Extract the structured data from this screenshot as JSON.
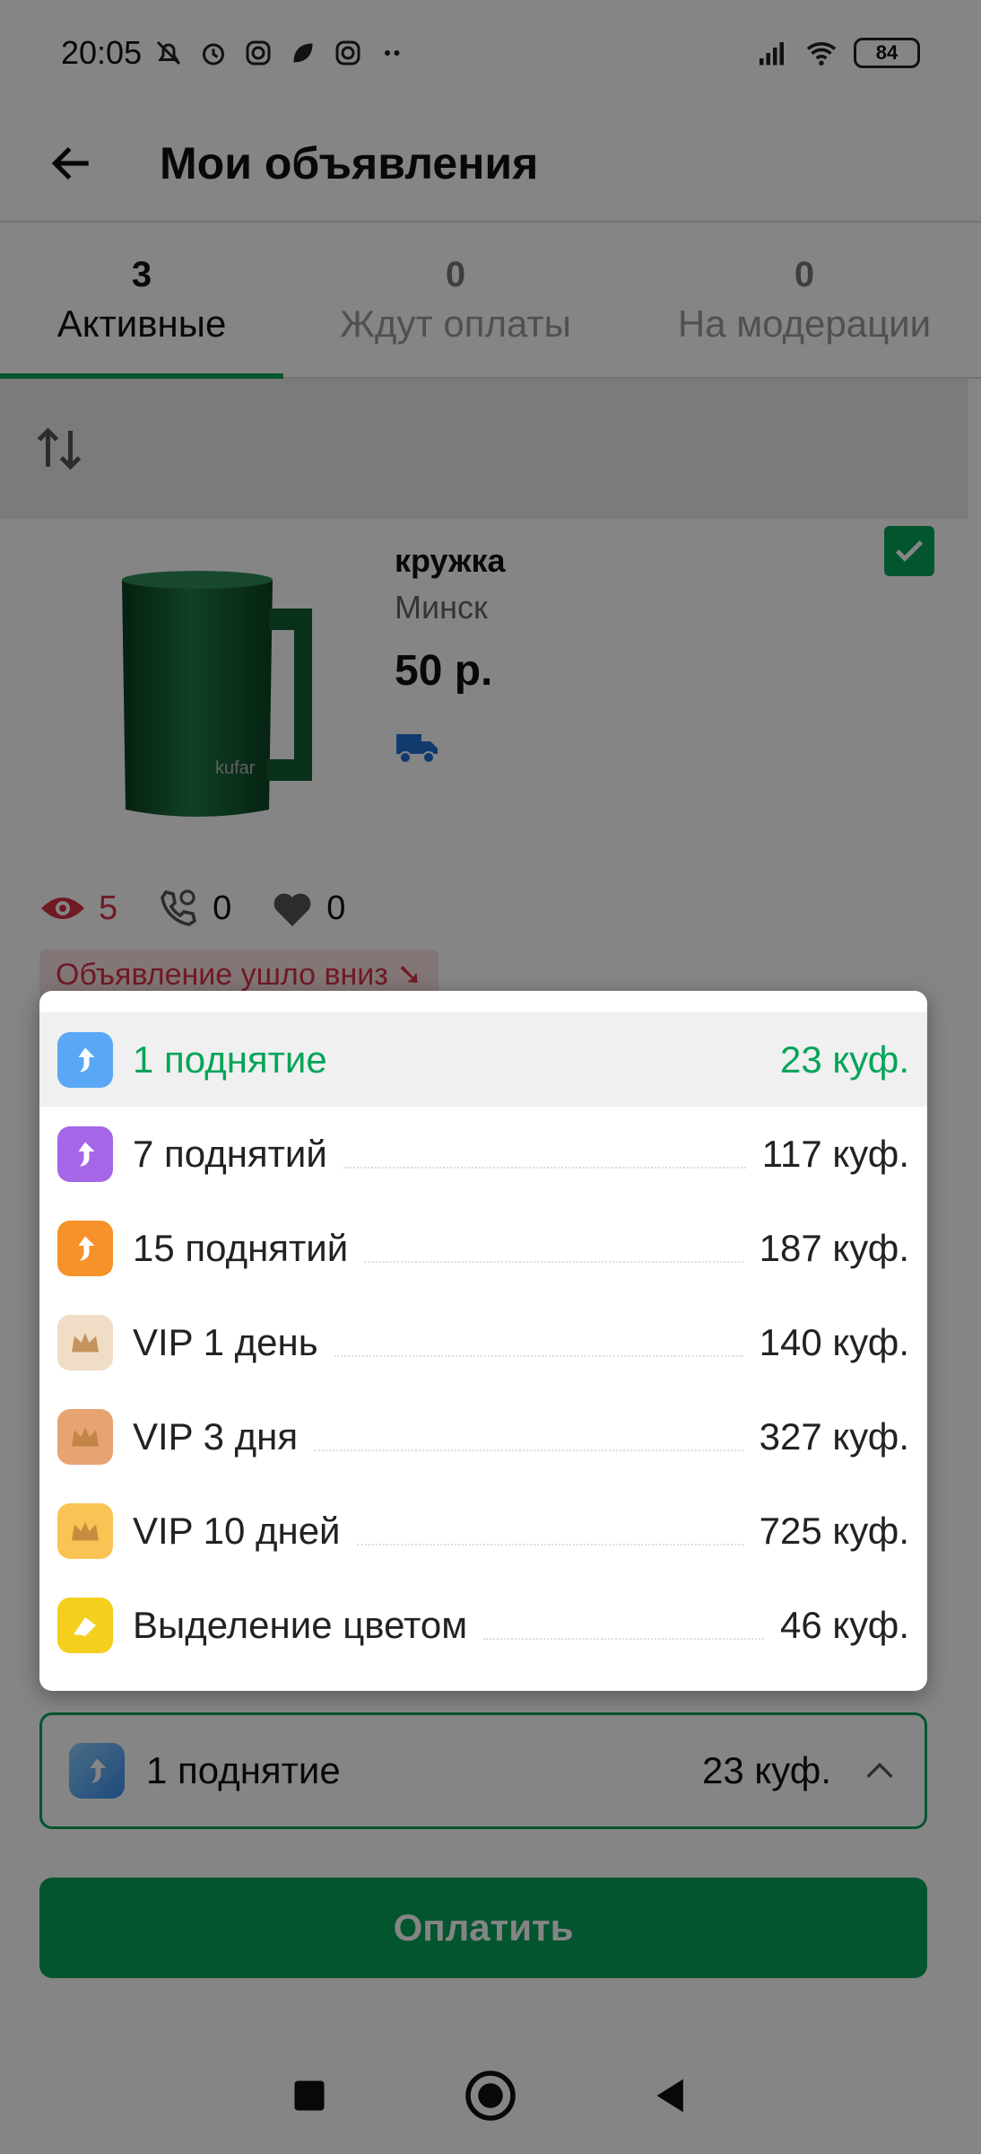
{
  "status_bar": {
    "time": "20:05",
    "battery": "84"
  },
  "app_bar": {
    "title": "Мои объявления"
  },
  "tabs": [
    {
      "count": "3",
      "label": "Активные"
    },
    {
      "count": "0",
      "label": "Ждут оплаты"
    },
    {
      "count": "0",
      "label": "На модерации"
    }
  ],
  "listing": {
    "title": "кружка",
    "city": "Минск",
    "price": "50 р.",
    "watermark": "kufar",
    "views": "5",
    "calls": "0",
    "likes": "0",
    "badge": "Объявление ушло вниз"
  },
  "dropdown": {
    "items": [
      {
        "label": "1 поднятие",
        "price": "23 куф.",
        "icon": "boost-arrow-icon",
        "color": "#5aa8f5"
      },
      {
        "label": "7 поднятий",
        "price": "117 куф.",
        "icon": "boost-arrow-icon",
        "color": "#a566e8"
      },
      {
        "label": "15 поднятий",
        "price": "187 куф.",
        "icon": "boost-arrow-icon",
        "color": "#f7912a"
      },
      {
        "label": "VIP 1 день",
        "price": "140 куф.",
        "icon": "crown-icon",
        "color": "#f0ddc6"
      },
      {
        "label": "VIP 3 дня",
        "price": "327 куф.",
        "icon": "crown-icon",
        "color": "#e8a372"
      },
      {
        "label": "VIP 10 дней",
        "price": "725 куф.",
        "icon": "crown-icon",
        "color": "#f9c453"
      },
      {
        "label": "Выделение цветом",
        "price": "46 куф.",
        "icon": "highlight-icon",
        "color": "#f4cf1d"
      }
    ]
  },
  "selected": {
    "label": "1 поднятие",
    "price": "23 куф."
  },
  "pay_button": {
    "label": "Оплатить"
  },
  "colors": {
    "accent": "#07a45a",
    "danger": "#d6334a"
  }
}
